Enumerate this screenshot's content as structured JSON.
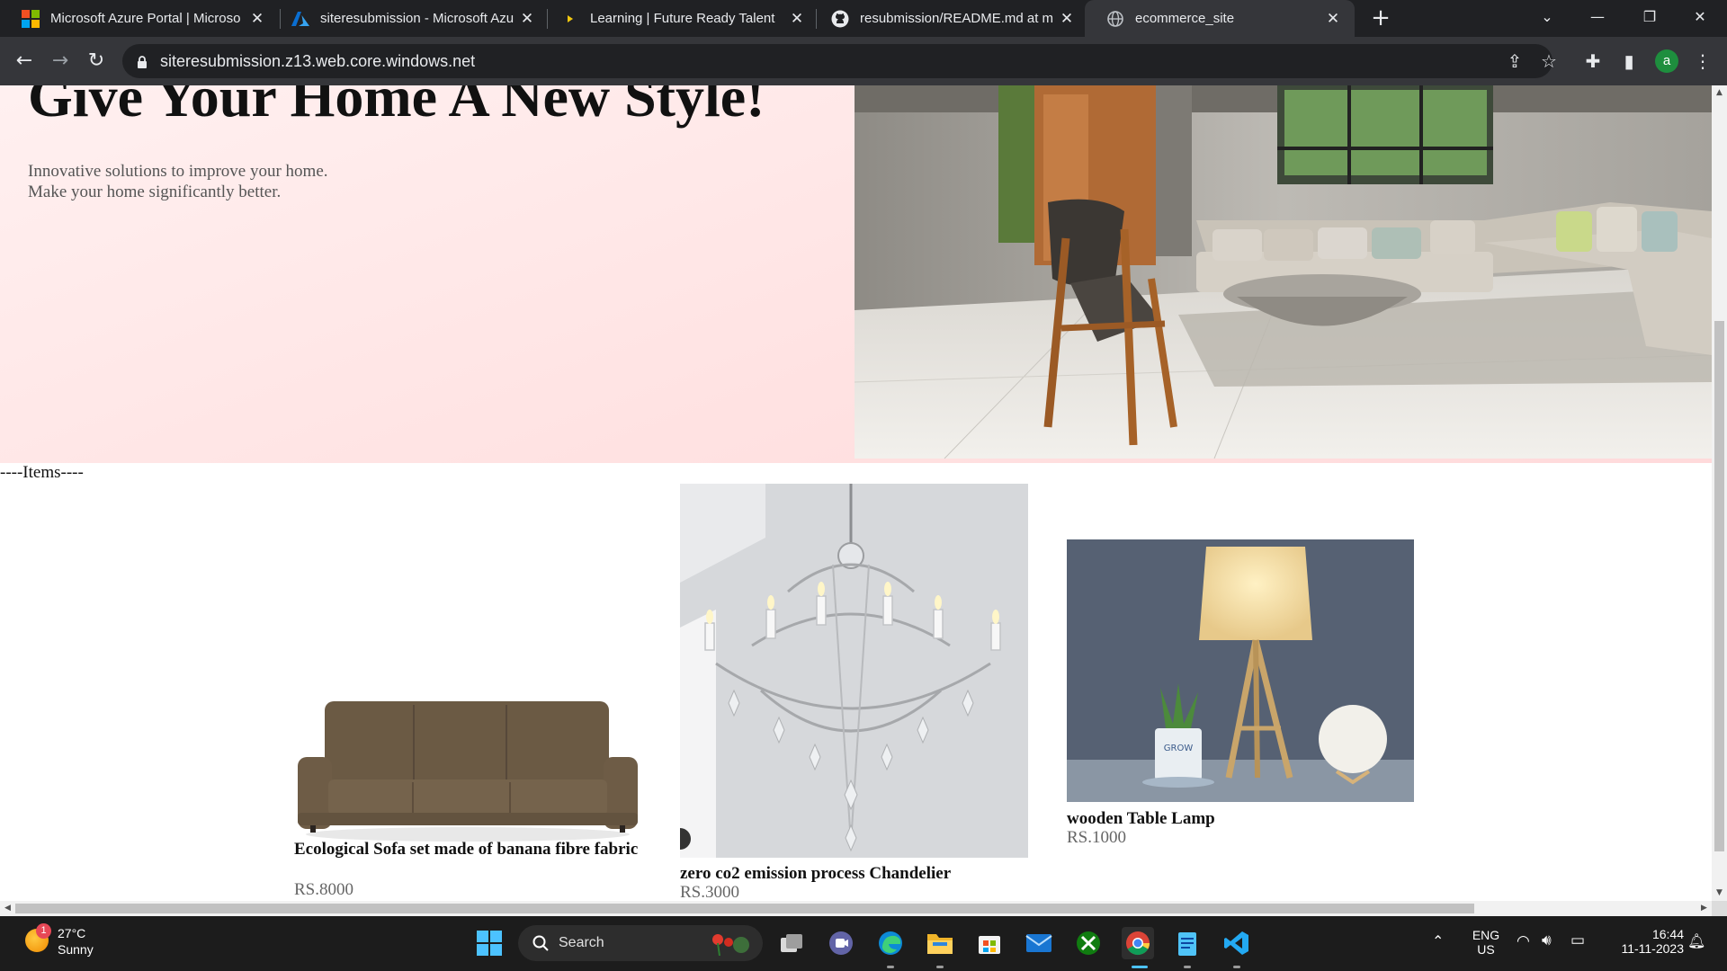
{
  "browser": {
    "tabs": [
      {
        "title": "Microsoft Azure Portal | Microso",
        "icon": "microsoft-logo-icon",
        "active": false
      },
      {
        "title": "siteresubmission - Microsoft Azu",
        "icon": "azure-logo-icon",
        "active": false
      },
      {
        "title": "Learning | Future Ready Talent",
        "icon": "learning-play-icon",
        "active": false
      },
      {
        "title": "resubmission/README.md at m",
        "icon": "github-logo-icon",
        "active": false
      },
      {
        "title": "ecommerce_site",
        "icon": "globe-icon",
        "active": true
      }
    ],
    "new_tab_label": "+",
    "address": "siteresubmission.z13.web.core.windows.net",
    "profile_initial": "a"
  },
  "page": {
    "hero": {
      "title": "Give Your Home A New Style!",
      "subtitle_line1": "Innovative solutions to improve your home.",
      "subtitle_line2": "Make your home significantly better."
    },
    "items_label": "----Items----",
    "products": [
      {
        "name": "Ecological Sofa set made of banana fibre fabric",
        "price": "RS.8000",
        "image": "brown-sofa-image"
      },
      {
        "name": "zero co2 emission process Chandelier",
        "price": "RS.3000",
        "image": "crystal-chandelier-image"
      },
      {
        "name": "wooden Table Lamp",
        "price": "RS.1000",
        "image": "wooden-table-lamp-image"
      }
    ]
  },
  "taskbar": {
    "weather": {
      "temp": "27°C",
      "condition": "Sunny",
      "badge": "1"
    },
    "search_label": "Search",
    "language": "ENG",
    "region": "US",
    "time": "16:44",
    "date": "11-11-2023"
  },
  "colors": {
    "hero_background": "#ffe2e2",
    "chrome_dark": "#202124",
    "chrome_toolbar": "#35363a"
  }
}
